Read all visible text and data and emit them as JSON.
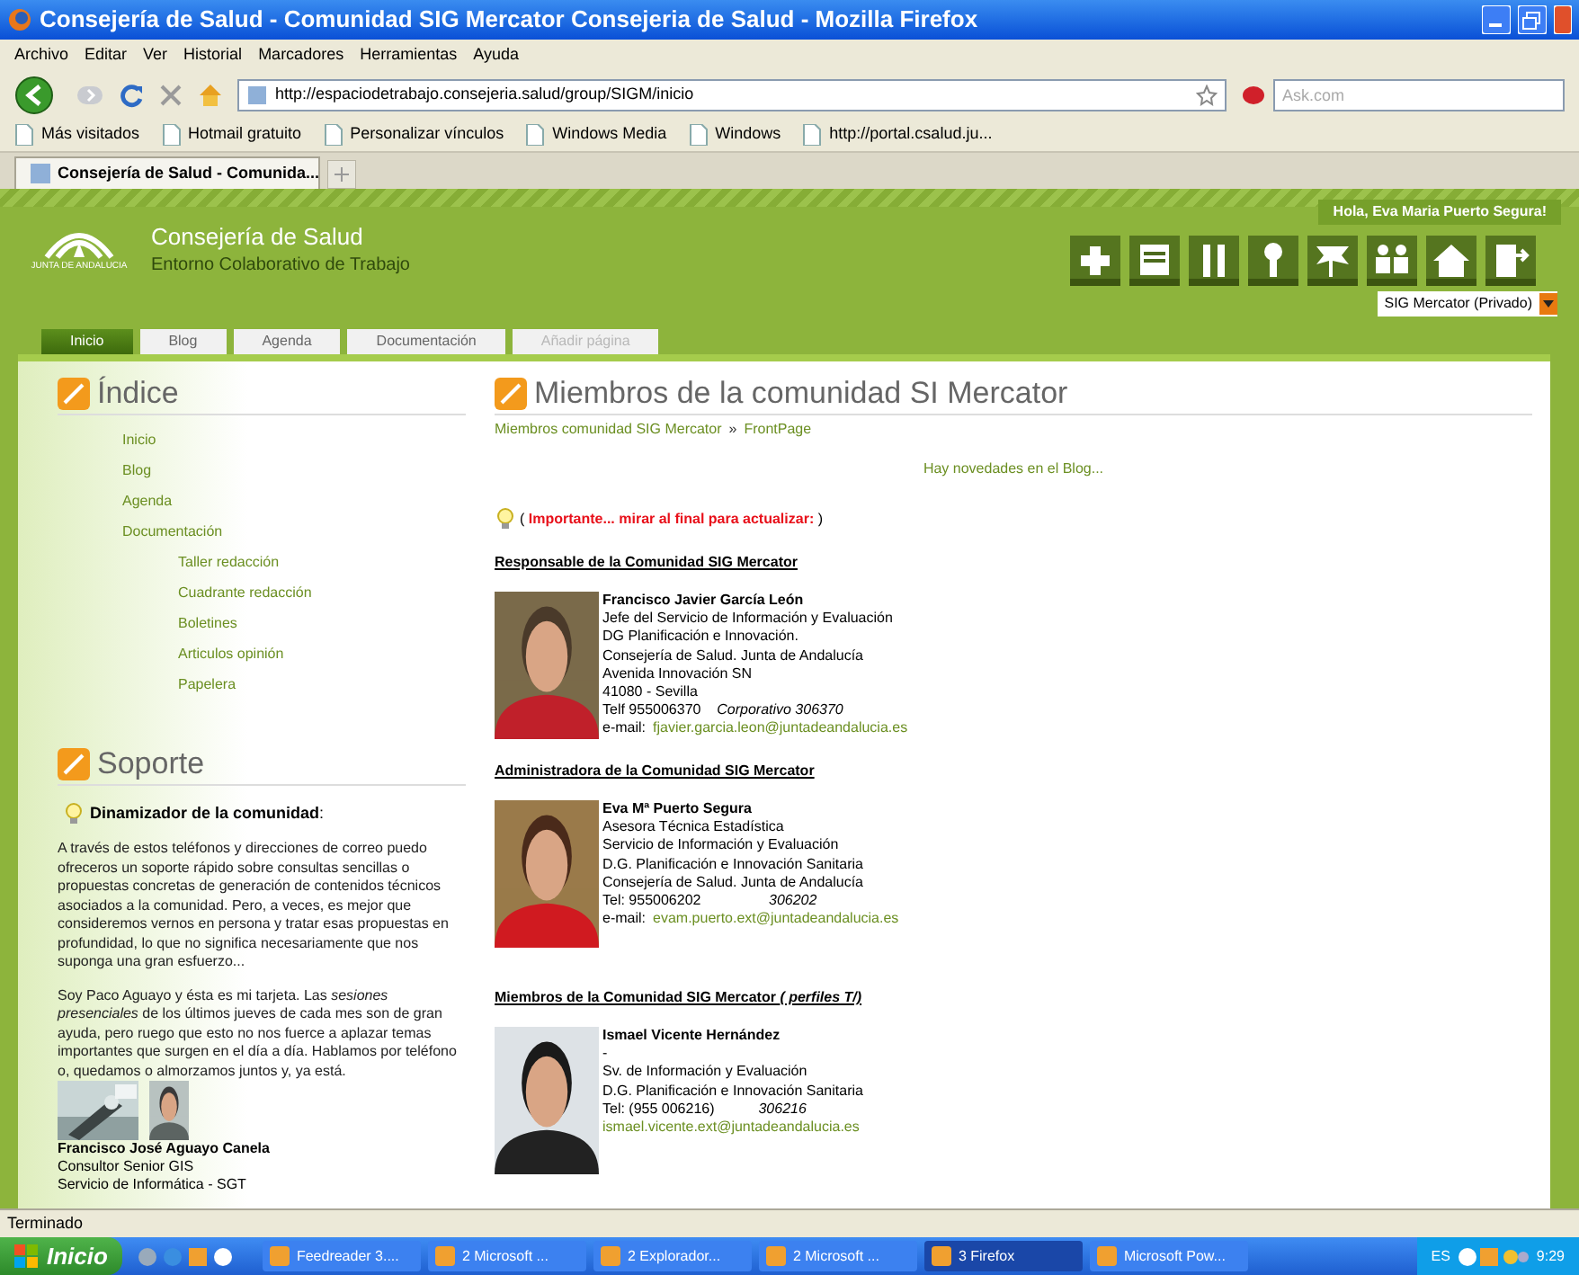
{
  "window": {
    "title": "Consejería de Salud - Comunidad SIG Mercator Consejeria de Salud - Mozilla Firefox"
  },
  "menu": [
    "Archivo",
    "Editar",
    "Ver",
    "Historial",
    "Marcadores",
    "Herramientas",
    "Ayuda"
  ],
  "toolbar": {
    "url": "http://espaciodetrabajo.consejeria.salud/group/SIGM/inicio",
    "search_placeholder": "Ask.com"
  },
  "bookmarks": [
    "Más visitados",
    "Hotmail gratuito",
    "Personalizar vínculos",
    "Windows Media",
    "Windows",
    "http://portal.csalud.ju..."
  ],
  "browser_tabs": [
    {
      "label": "Consejería de Salud - Comunida...",
      "selected": true
    }
  ],
  "site": {
    "logo_text": "JUNTA DE ANDALUCIA",
    "name": "Consejería de Salud",
    "subtitle": "Entorno Colaborativo de Trabajo",
    "greeting": "Hola, Eva Maria Puerto Segura!",
    "community_select": "SIG Mercator (Privado)"
  },
  "header_tools": [
    {
      "kind": "plus"
    },
    {
      "kind": "layout"
    },
    {
      "kind": "tools"
    },
    {
      "kind": "key"
    },
    {
      "kind": "flag"
    },
    {
      "kind": "people"
    },
    {
      "kind": "house"
    },
    {
      "kind": "exit"
    }
  ],
  "nav_tabs": [
    {
      "label": "Inicio",
      "selected": true,
      "disabled": false
    },
    {
      "label": "Blog",
      "selected": false,
      "disabled": false
    },
    {
      "label": "Agenda",
      "selected": false,
      "disabled": false
    },
    {
      "label": "Documentación",
      "selected": false,
      "disabled": false
    },
    {
      "label": "Añadir página",
      "selected": false,
      "disabled": true
    }
  ],
  "index": {
    "title": "Índice",
    "items": [
      {
        "label": "Inicio"
      },
      {
        "label": "Blog"
      },
      {
        "label": "Agenda"
      },
      {
        "label": "Documentación",
        "children": [
          {
            "label": "Taller redacción"
          },
          {
            "label": "Cuadrante redacción"
          },
          {
            "label": "Boletines"
          },
          {
            "label": "Articulos opinión"
          },
          {
            "label": "Papelera"
          }
        ]
      }
    ]
  },
  "support": {
    "title": "Soporte",
    "heading": "**Dinamizador de la comunidad**:",
    "paragraphs": [
      "A través de estos teléfonos y direcciones de correo puedo ofreceros un soporte rápido sobre consultas sencillas o propuestas concretas de generación de contenidos técnicos asociados a la comunidad. Pero, a veces, es mejor que consideremos vernos en persona y tratar esas propuestas en profundidad, lo que no significa necesariamente que nos suponga una gran esfuerzo...",
      "Soy Paco Aguayo y ésta es mi tarjeta. Las *sesiones presenciales* de los últimos jueves de cada mes son de gran ayuda, pero ruego que esto no nos fuerce a aplazar temas importantes que surgen en el día a día. Hablamos por teléfono o, quedamos o almorzamos juntos y, ya está."
    ],
    "person": {
      "name": "Francisco José Aguayo Canela",
      "lines": [
        "Consultor Senior GIS",
        "Servicio de Informática - SGT"
      ]
    }
  },
  "main": {
    "title": "Miembros de la comunidad SI Mercator",
    "breadcrumb": [
      "Miembros comunidad SIG Mercator",
      "FrontPage"
    ],
    "breadcrumb_separator": "»",
    "notice": "Hay novedades en el Blog...",
    "important": {
      "open": "(",
      "text": "Importante... mirar al final para actualizar:",
      "close": ")"
    },
    "sections": [
      {
        "heading": "Responsable de la Comunidad SIG Mercator",
        "people": [
          {
            "name": "Francisco Javier García León",
            "lines": [
              "Jefe del Servicio de Información y Evaluación",
              "DG Planificación e Innovación.",
              "Consejería de Salud. Junta de Andalucía",
              "Avenida Innovación SN",
              "41080 - Sevilla",
              "Telf 955006370    *Corporativo 306370*"
            ],
            "email_label": "e-mail:",
            "email": "fjavier.garcia.leon@juntadeandalucia.es"
          }
        ]
      },
      {
        "heading": "Administradora de la Comunidad SIG Mercator",
        "people": [
          {
            "name": "Eva Mª Puerto Segura",
            "lines": [
              "Asesora Técnica Estadística",
              "Servicio de Información y Evaluación",
              "D.G. Planificación e Innovación Sanitaria",
              "Consejería de Salud. Junta de Andalucía",
              "Tel: 955006202                 *306202*"
            ],
            "email_label": "e-mail:",
            "email": "evam.puerto.ext@juntadeandalucia.es"
          }
        ]
      },
      {
        "heading": "Miembros de la Comunidad SIG Mercator *( perfiles T/)*",
        "people": [
          {
            "name": "Ismael Vicente Hernández",
            "lines": [
              "-",
              "Sv. de Información y Evaluación",
              "D.G. Planificación e Innovación Sanitaria",
              "Tel: (955 006216)           *306216*"
            ],
            "email": "ismael.vicente.ext@juntadeandalucia.es"
          }
        ]
      }
    ]
  },
  "status_bar": "Terminado",
  "taskbar": {
    "start": "Inicio",
    "items": [
      {
        "label": "Feedreader 3....",
        "selected": false
      },
      {
        "label": "2 Microsoft ...",
        "selected": false
      },
      {
        "label": "2 Explorador...",
        "selected": false
      },
      {
        "label": "2 Microsoft ...",
        "selected": false
      },
      {
        "label": "3 Firefox",
        "selected": true
      },
      {
        "label": "Microsoft Pow...",
        "selected": false
      }
    ],
    "language": "ES",
    "clock": "9:29"
  }
}
